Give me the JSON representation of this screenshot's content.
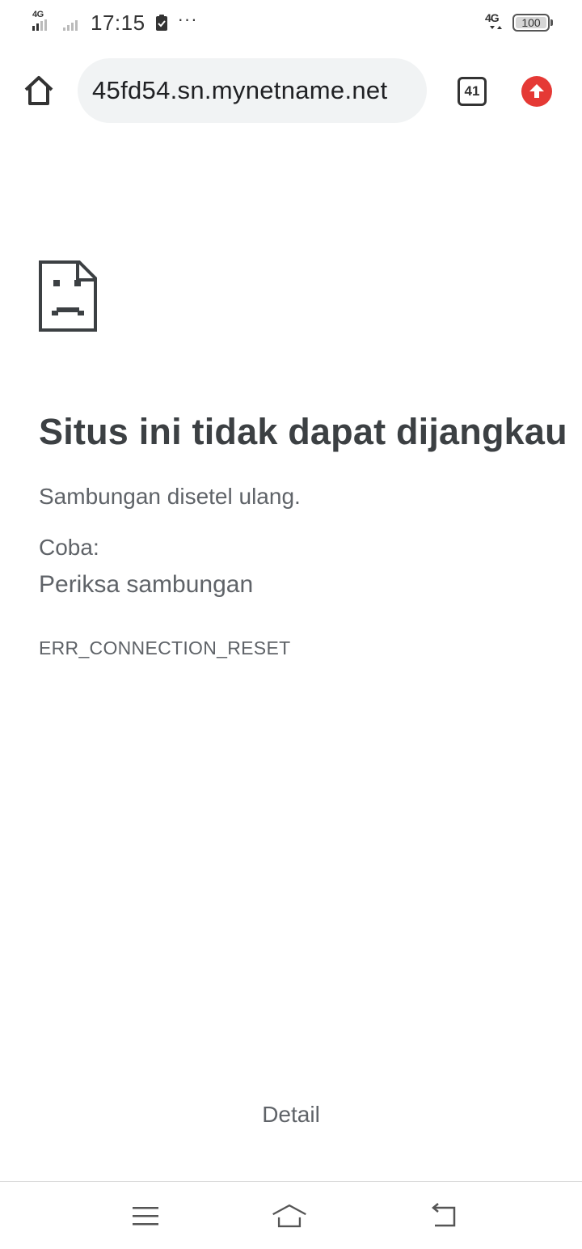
{
  "status_bar": {
    "network_left": "4G",
    "time": "17:15",
    "overflow": "···",
    "network_right": "4G",
    "battery": "100"
  },
  "toolbar": {
    "url": "45fd54.sn.mynetname.net",
    "tab_count": "41"
  },
  "error_page": {
    "title": "Situs ini tidak dapat dijangkau",
    "subtitle": "Sambungan disetel ulang.",
    "try_label": "Coba:",
    "suggestion": "Periksa sambungan",
    "error_code": "ERR_CONNECTION_RESET",
    "details_button": "Detail"
  },
  "icons": {
    "home": "home-icon",
    "tabs": "tabs-icon",
    "update": "update-arrow-icon",
    "error": "sad-document-icon",
    "nav_menu": "menu-icon",
    "nav_home": "home-nav-icon",
    "nav_back": "back-icon"
  },
  "colors": {
    "update_badge": "#e53935",
    "url_bg": "#f1f3f4",
    "text": "#3c4043"
  }
}
